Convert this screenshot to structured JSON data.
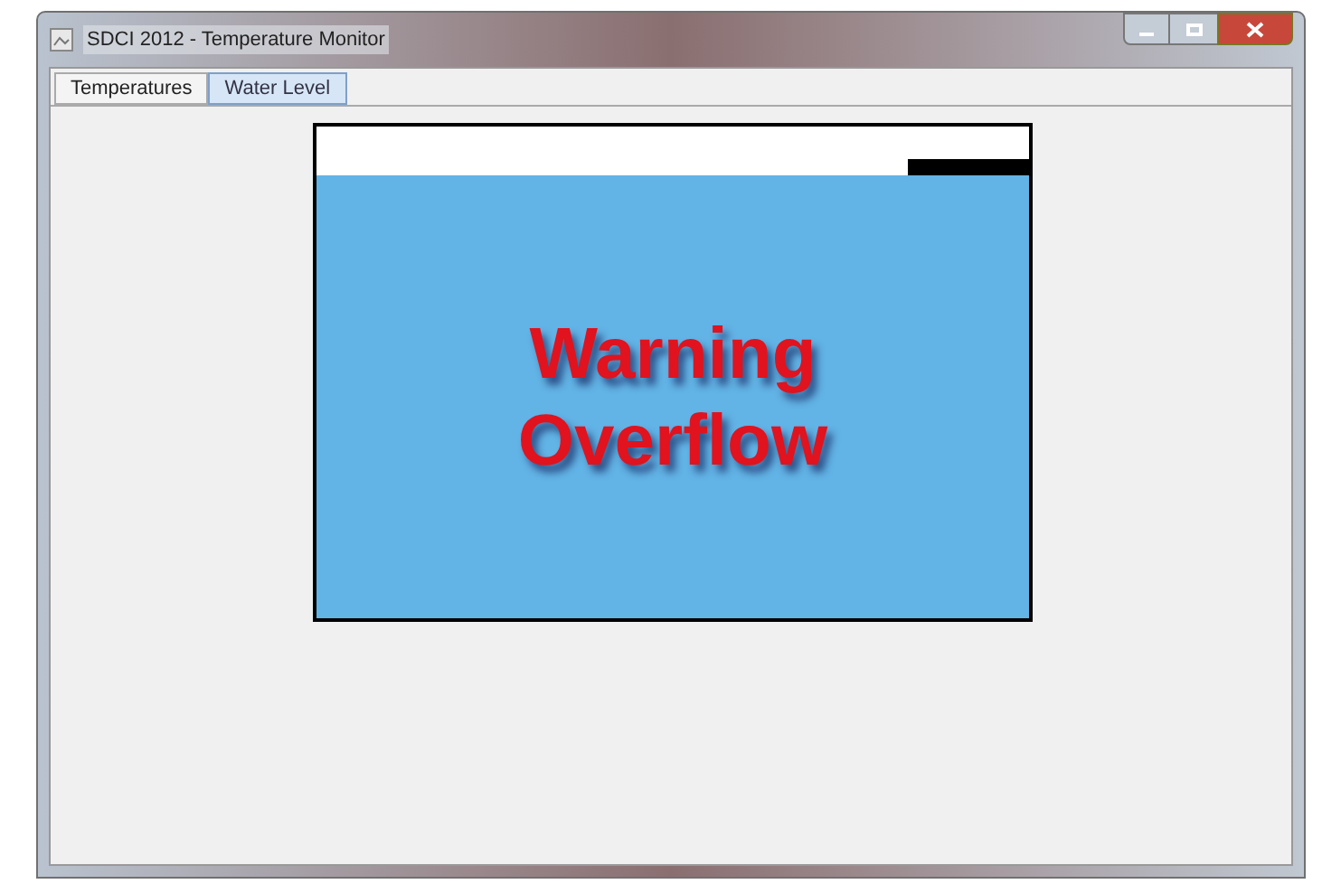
{
  "window": {
    "title": "SDCI 2012 - Temperature Monitor"
  },
  "tabs": [
    {
      "label": "Temperatures",
      "selected": false
    },
    {
      "label": "Water Level",
      "selected": true
    }
  ],
  "tank": {
    "warning": [
      "Warning",
      "Overflow"
    ]
  }
}
